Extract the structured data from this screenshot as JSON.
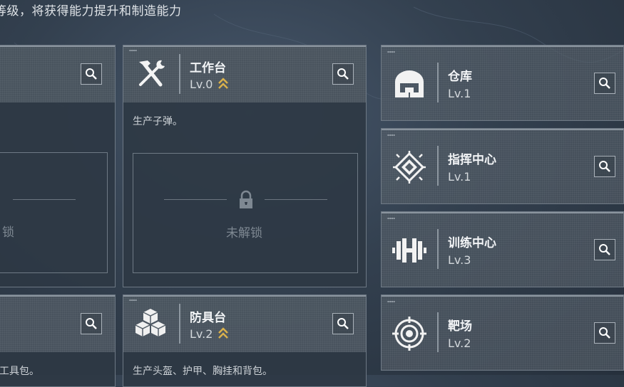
{
  "header": {
    "text": "等级，将获得能力提升和制造能力"
  },
  "cards": {
    "left_top": {
      "lock_text": "锁"
    },
    "left_bottom": {
      "desc": "工具包。"
    },
    "workbench": {
      "name": "工作台",
      "level": "Lv.0",
      "desc": "生产子弹。",
      "lock_text": "未解锁",
      "icon": "hammer-wrench-icon"
    },
    "armor": {
      "name": "防具台",
      "level": "Lv.2",
      "desc": "生产头盔、护甲、胸挂和背包。",
      "icon": "cubes-icon"
    }
  },
  "facilities": [
    {
      "name": "仓库",
      "level": "Lv.1",
      "icon": "warehouse-icon"
    },
    {
      "name": "指挥中心",
      "level": "Lv.1",
      "icon": "chip-icon"
    },
    {
      "name": "训练中心",
      "level": "Lv.3",
      "icon": "dumbbell-icon"
    },
    {
      "name": "靶场",
      "level": "Lv.2",
      "icon": "target-icon"
    }
  ],
  "colors": {
    "upgrade_arrow": "#d9b04c",
    "panel": "#2e3844",
    "header_panel": "#545e68"
  }
}
